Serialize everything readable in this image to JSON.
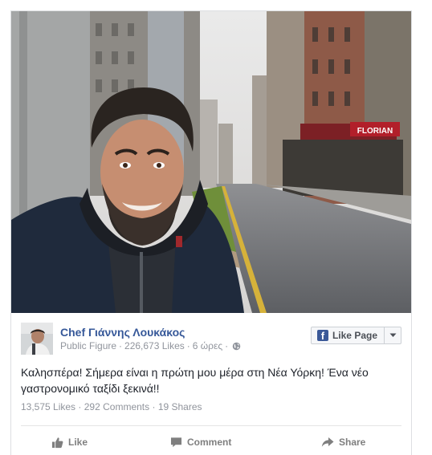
{
  "post": {
    "page_name": "Chef Γιάννης Λουκάκος",
    "category": "Public Figure",
    "likes_count": "226,673 Likes",
    "time": "6 ώρες",
    "like_page_label": "Like Page",
    "fb_icon_glyph": "f",
    "message_line1": "Καλησπέρα! Σήμερα είναι η πρώτη μου μέρα στη Νέα Υόρκη! Ένα νέο",
    "message_line2": "γαστρονομικό ταξίδι ξεκινά!!",
    "stats": {
      "likes": "13,575 Likes",
      "comments": "292 Comments",
      "shares": "19 Shares"
    },
    "actions": {
      "like": "Like",
      "comment": "Comment",
      "share": "Share"
    },
    "photo": {
      "storefront_sign": "FLORIAN"
    }
  },
  "colors": {
    "link_blue": "#365899",
    "facebook_blue": "#3b5998",
    "meta_gray": "#90949c",
    "action_gray": "#7f7f7f"
  },
  "icons": {
    "globe": "globe-icon",
    "like": "thumbs-up-icon",
    "comment": "comment-bubble-icon",
    "share": "share-arrow-icon",
    "dropdown": "chevron-down-icon"
  }
}
